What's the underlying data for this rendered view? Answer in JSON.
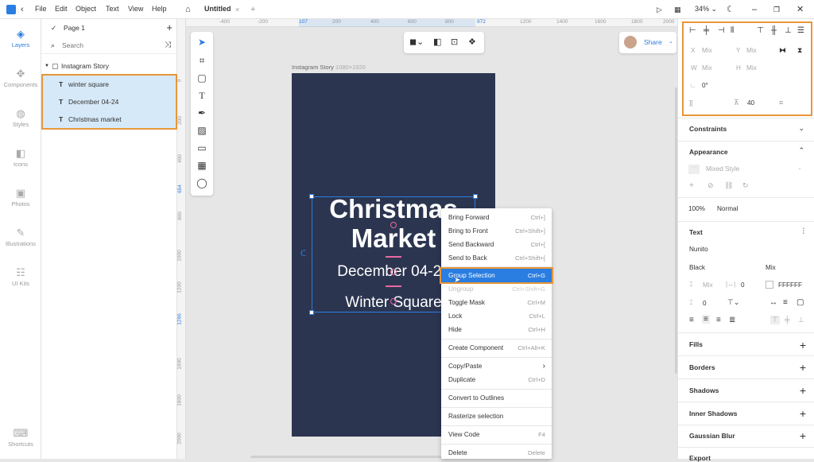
{
  "menu": [
    "File",
    "Edit",
    "Object",
    "Text",
    "View",
    "Help"
  ],
  "doc_tab": {
    "title": "Untitled"
  },
  "zoom": "34%",
  "rail": [
    {
      "label": "Layers"
    },
    {
      "label": "Components"
    },
    {
      "label": "Styles"
    },
    {
      "label": "Icons"
    },
    {
      "label": "Photos"
    },
    {
      "label": "Illustrations"
    },
    {
      "label": "UI Kits"
    },
    {
      "label": "Shortcuts"
    }
  ],
  "layers": {
    "page": "Page 1",
    "search_placeholder": "Search",
    "artboard": "Instagram Story",
    "items": [
      "winter square",
      "December 04-24",
      "Christmas market"
    ]
  },
  "hruler": [
    "-400",
    "-200",
    "107",
    "200",
    "400",
    "600",
    "800",
    "972",
    "1200",
    "1400",
    "1600",
    "1800",
    "2000"
  ],
  "vruler": [
    "0",
    "200",
    "400",
    "654",
    "800",
    "1000",
    "1200",
    "1266",
    "1600",
    "1800",
    "2000"
  ],
  "artboard": {
    "name": "Instagram Story",
    "size": "1080×1920",
    "title_line1": "Christmas",
    "title_line2": "Market",
    "date": "December 04-24",
    "place": "Winter Square"
  },
  "share": {
    "label": "Share"
  },
  "context_menu": [
    {
      "label": "Bring Forward",
      "shortcut": "Ctrl+]"
    },
    {
      "label": "Bring to Front",
      "shortcut": "Ctrl+Shift+]"
    },
    {
      "label": "Send Backward",
      "shortcut": "Ctrl+["
    },
    {
      "label": "Send to Back",
      "shortcut": "Ctrl+Shift+["
    },
    {
      "label": "Group Selection",
      "shortcut": "Ctrl+G"
    },
    {
      "label": "Ungroup",
      "shortcut": "Ctrl+Shift+G"
    },
    {
      "label": "Toggle Mask",
      "shortcut": "Ctrl+M"
    },
    {
      "label": "Lock",
      "shortcut": "Ctrl+L"
    },
    {
      "label": "Hide",
      "shortcut": "Ctrl+H"
    },
    {
      "label": "Create Component",
      "shortcut": "Ctrl+Alt+K"
    },
    {
      "label": "Copy/Paste",
      "shortcut": ""
    },
    {
      "label": "Duplicate",
      "shortcut": "Ctrl+D"
    },
    {
      "label": "Convert to Outlines",
      "shortcut": ""
    },
    {
      "label": "Rasterize selection",
      "shortcut": ""
    },
    {
      "label": "View Code",
      "shortcut": "F4"
    },
    {
      "label": "Delete",
      "shortcut": "Delete"
    }
  ],
  "inspector": {
    "x": "X",
    "x_val": "Mix",
    "y": "Y",
    "y_val": "Mix",
    "w": "W",
    "w_val": "Mix",
    "h": "H",
    "h_val": "Mix",
    "rotation": "0°",
    "spacing": "40",
    "constraints": "Constraints",
    "appearance": "Appearance",
    "mixed_style": "Mixed Style",
    "opacity": "100%",
    "blend": "Normal",
    "text": "Text",
    "font": "Nunito",
    "weight": "Black",
    "size": "Mix",
    "line_height": "Mix",
    "letter": "0",
    "para": "0",
    "color": "FFFFFF",
    "fills": "Fills",
    "borders": "Borders",
    "shadows": "Shadows",
    "inner_shadows": "Inner Shadows",
    "gaussian_blur": "Gaussian Blur",
    "export": "Export"
  },
  "colors": {
    "accent": "#2a7de1",
    "highlight": "#e8963a",
    "artboard": "#2c3550",
    "selection": "#d6e9f8"
  }
}
